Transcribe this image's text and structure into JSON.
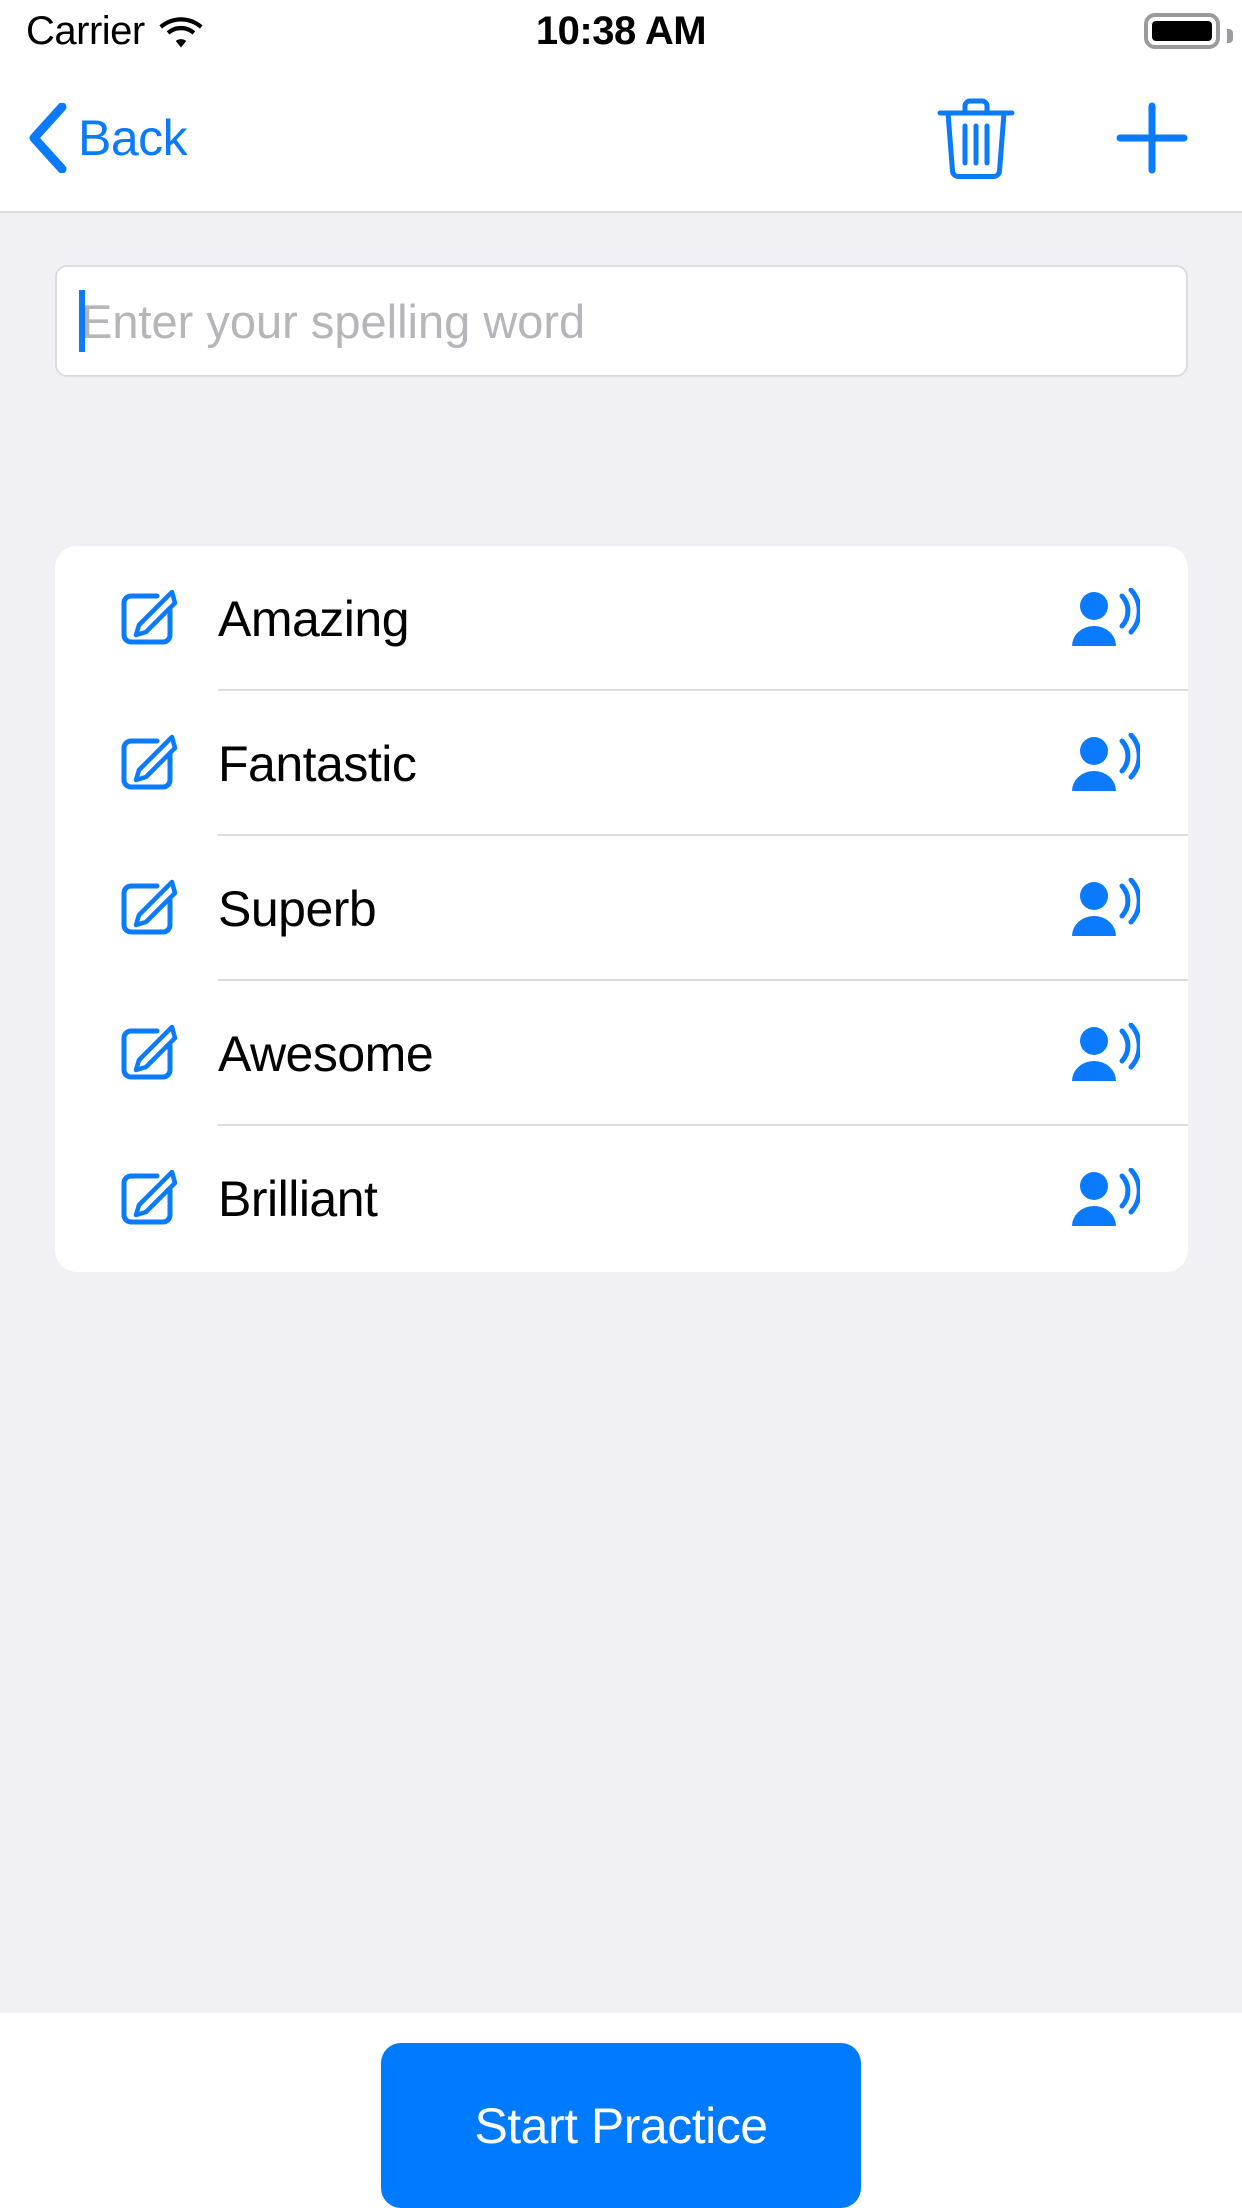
{
  "status_bar": {
    "carrier": "Carrier",
    "wifi_icon": "wifi-icon",
    "time": "10:38 AM",
    "battery_icon": "battery-full-icon"
  },
  "nav_bar": {
    "back_label": "Back",
    "back_icon": "chevron-left-icon",
    "trash_icon": "trash-icon",
    "add_icon": "plus-icon"
  },
  "input": {
    "placeholder": "Enter your spelling word",
    "value": ""
  },
  "word_list": {
    "edit_icon": "square-and-pencil-icon",
    "speak_icon": "person-wave-icon",
    "items": [
      {
        "word": "Amazing"
      },
      {
        "word": "Fantastic"
      },
      {
        "word": "Superb"
      },
      {
        "word": "Awesome"
      },
      {
        "word": "Brilliant"
      }
    ]
  },
  "footer": {
    "start_practice_label": "Start Practice"
  },
  "colors": {
    "accent": "#007AFF",
    "tint": "#0A7AFF",
    "background": "#F1F1F5",
    "card": "#FFFFFF",
    "separator": "#DCDCE1",
    "placeholder": "#B5B5BA",
    "text": "#000000"
  }
}
